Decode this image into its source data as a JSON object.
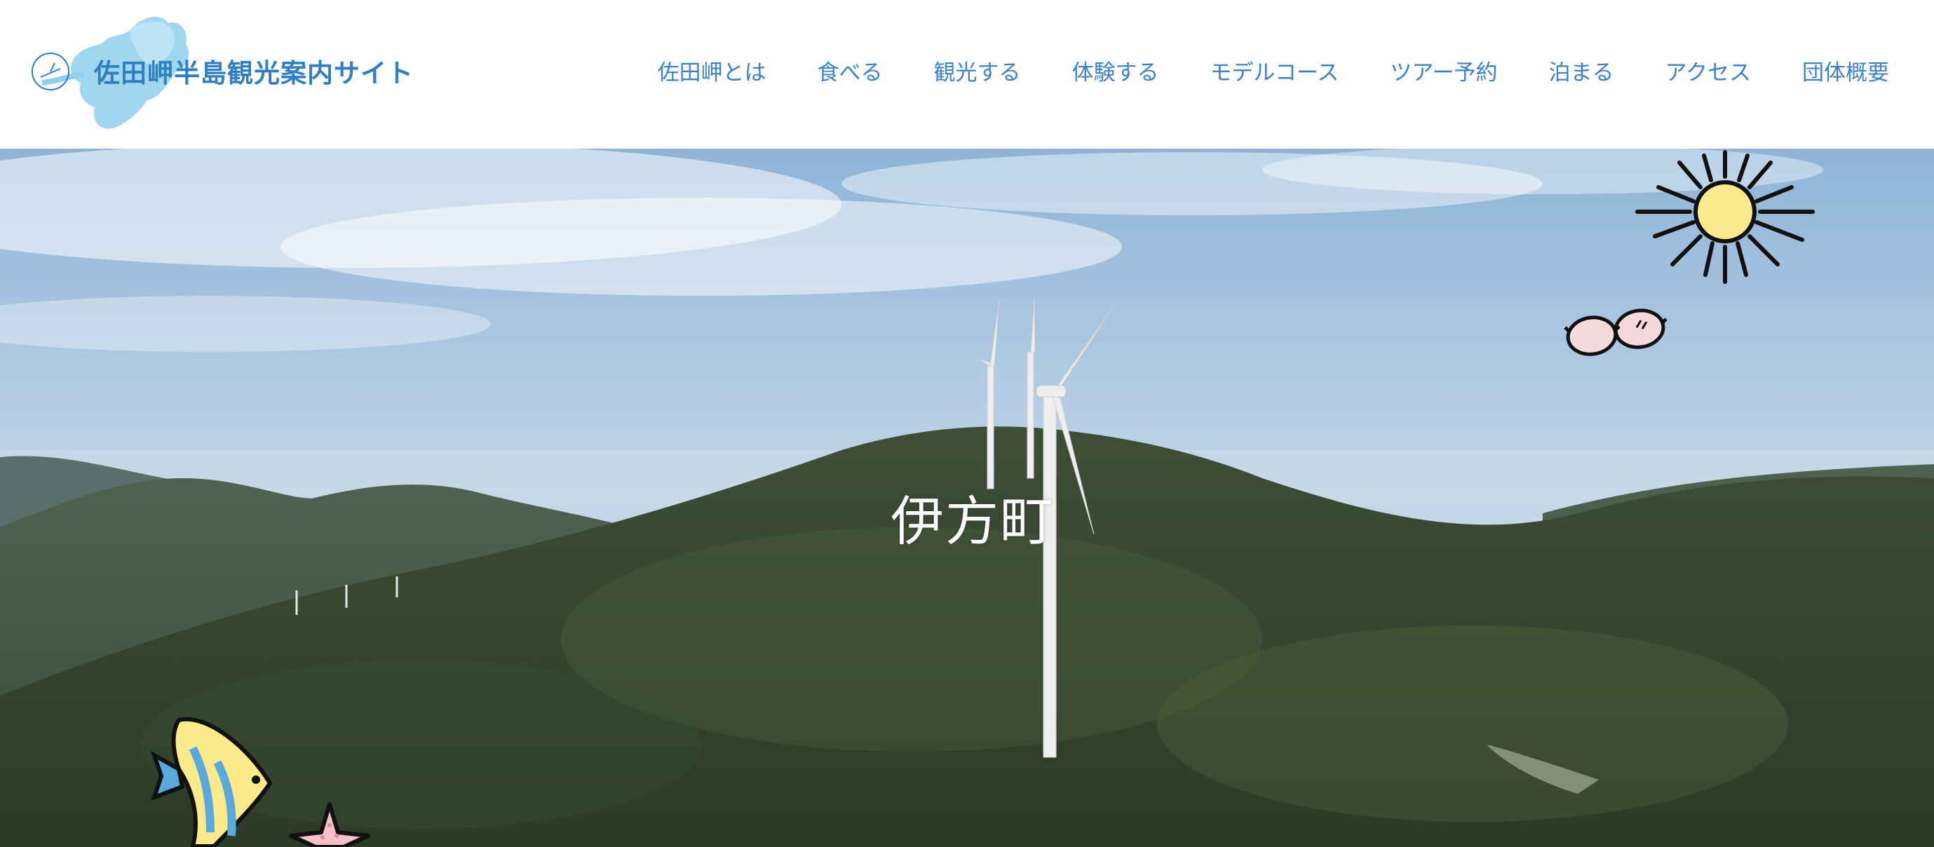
{
  "site": {
    "title": "佐田岬半島観光案内サイト"
  },
  "nav": {
    "items": [
      {
        "label": "佐田岬とは"
      },
      {
        "label": "食べる"
      },
      {
        "label": "観光する"
      },
      {
        "label": "体験する"
      },
      {
        "label": "モデルコース"
      },
      {
        "label": "ツアー予約"
      },
      {
        "label": "泊まる"
      },
      {
        "label": "アクセス"
      },
      {
        "label": "団体概要"
      }
    ]
  },
  "hero": {
    "title": "伊方町",
    "decorations": [
      "sun-icon",
      "sunglasses-icon",
      "angelfish-icon",
      "starfish-icon"
    ]
  },
  "colors": {
    "brand": "#2f7fc4",
    "nav": "#3a82cc",
    "logo_map": "#8fd0ec",
    "sun": "#fbe98a"
  }
}
